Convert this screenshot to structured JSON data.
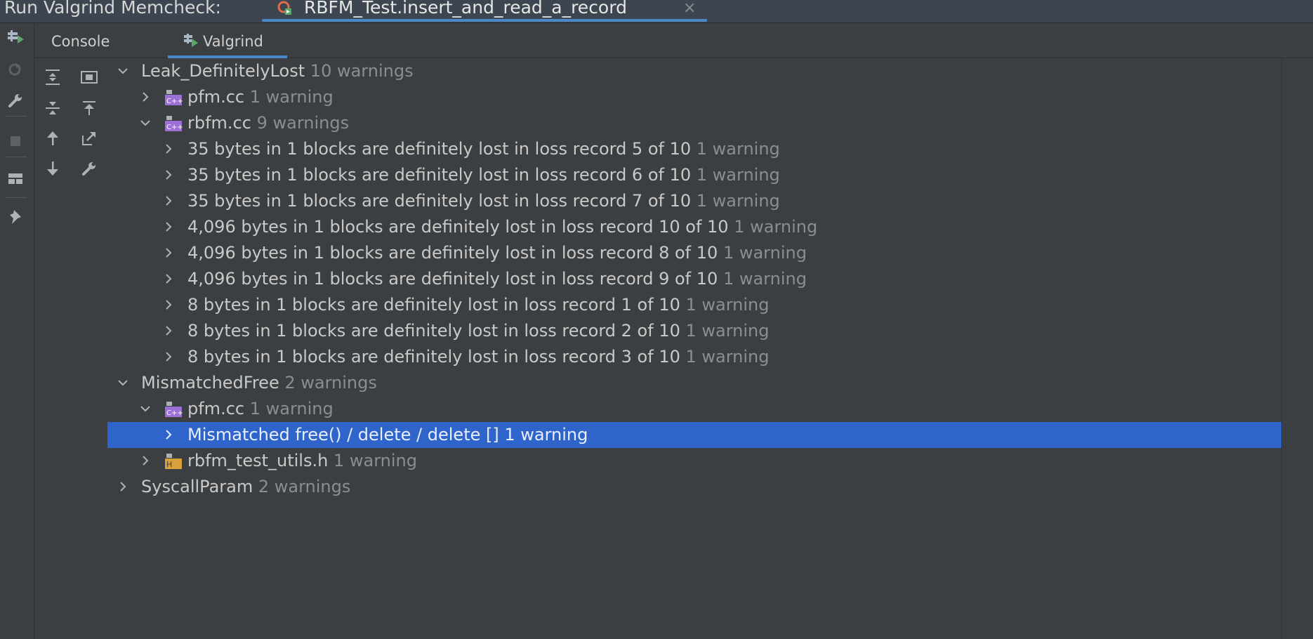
{
  "title_bar": {
    "label": "Run Valgrind Memcheck:",
    "run_tab_name": "RBFM_Test.insert_and_read_a_record",
    "close_glyph": "×"
  },
  "tabs": [
    {
      "label": "Console"
    },
    {
      "label": "Valgrind"
    }
  ],
  "tree": [
    {
      "label": "Leak_DefinitelyLost",
      "count": "10 warnings"
    },
    {
      "label": "pfm.cc",
      "count": "1 warning"
    },
    {
      "label": "rbfm.cc",
      "count": "9 warnings"
    },
    {
      "label": "35 bytes in 1 blocks are definitely lost in loss record 5 of 10",
      "count": "1 warning"
    },
    {
      "label": "35 bytes in 1 blocks are definitely lost in loss record 6 of 10",
      "count": "1 warning"
    },
    {
      "label": "35 bytes in 1 blocks are definitely lost in loss record 7 of 10",
      "count": "1 warning"
    },
    {
      "label": "4,096 bytes in 1 blocks are definitely lost in loss record 10 of 10",
      "count": "1 warning"
    },
    {
      "label": "4,096 bytes in 1 blocks are definitely lost in loss record 8 of 10",
      "count": "1 warning"
    },
    {
      "label": "4,096 bytes in 1 blocks are definitely lost in loss record 9 of 10",
      "count": "1 warning"
    },
    {
      "label": "8 bytes in 1 blocks are definitely lost in loss record 1 of 10",
      "count": "1 warning"
    },
    {
      "label": "8 bytes in 1 blocks are definitely lost in loss record 2 of 10",
      "count": "1 warning"
    },
    {
      "label": "8 bytes in 1 blocks are definitely lost in loss record 3 of 10",
      "count": "1 warning"
    },
    {
      "label": "MismatchedFree",
      "count": "2 warnings"
    },
    {
      "label": "pfm.cc",
      "count": "1 warning"
    },
    {
      "label": "Mismatched free() / delete / delete []",
      "count": "1 warning"
    },
    {
      "label": "rbfm_test_utils.h",
      "count": "1 warning"
    },
    {
      "label": "SyscallParam",
      "count": "2 warnings"
    }
  ],
  "colors": {
    "selection": "#2f65ca",
    "accent_underline": "#4a88c7",
    "cpp_file_icon": "#9b6fd6",
    "header_file_icon": "#d9a13b"
  },
  "icons": {
    "file_cpp": "cpp-file-icon",
    "file_header": "header-file-icon"
  }
}
